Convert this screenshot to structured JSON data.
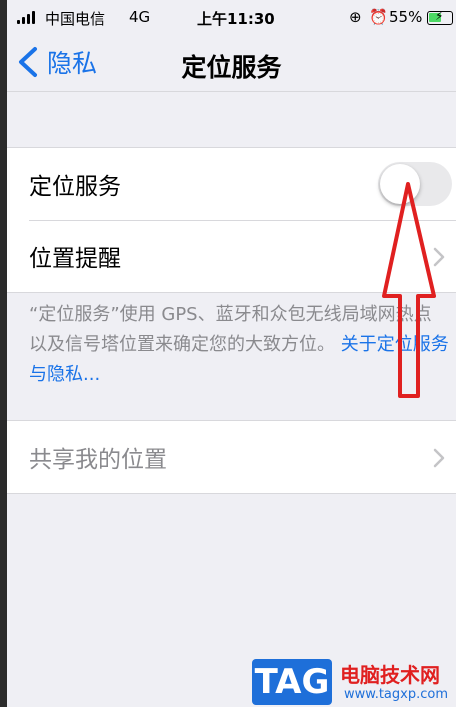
{
  "status_bar": {
    "carrier": "中国电信",
    "network": "4G",
    "time": "上午11:30",
    "battery_percent": "55%",
    "battery_level": 0.55,
    "icons": [
      "signal-icon",
      "lock-rotation-icon",
      "alarm-icon",
      "battery-charging-icon"
    ]
  },
  "nav": {
    "back_label": "隐私",
    "title": "定位服务"
  },
  "settings": {
    "location_services_label": "定位服务",
    "location_services_enabled": false,
    "location_alerts_label": "位置提醒",
    "footnote_text": "“定位服务”使用 GPS、蓝牙和众包无线局域网热点以及信号塔位置来确定您的大致方位。",
    "footnote_link": "关于定位服务与隐私...",
    "share_location_label": "共享我的位置"
  },
  "colors": {
    "accent": "#1a73e8",
    "arrow": "#e02020",
    "background": "#efeff4"
  },
  "watermark": {
    "logo_text": "TAG",
    "site_name": "电脑技术网",
    "url": "www.tagxp.com"
  }
}
